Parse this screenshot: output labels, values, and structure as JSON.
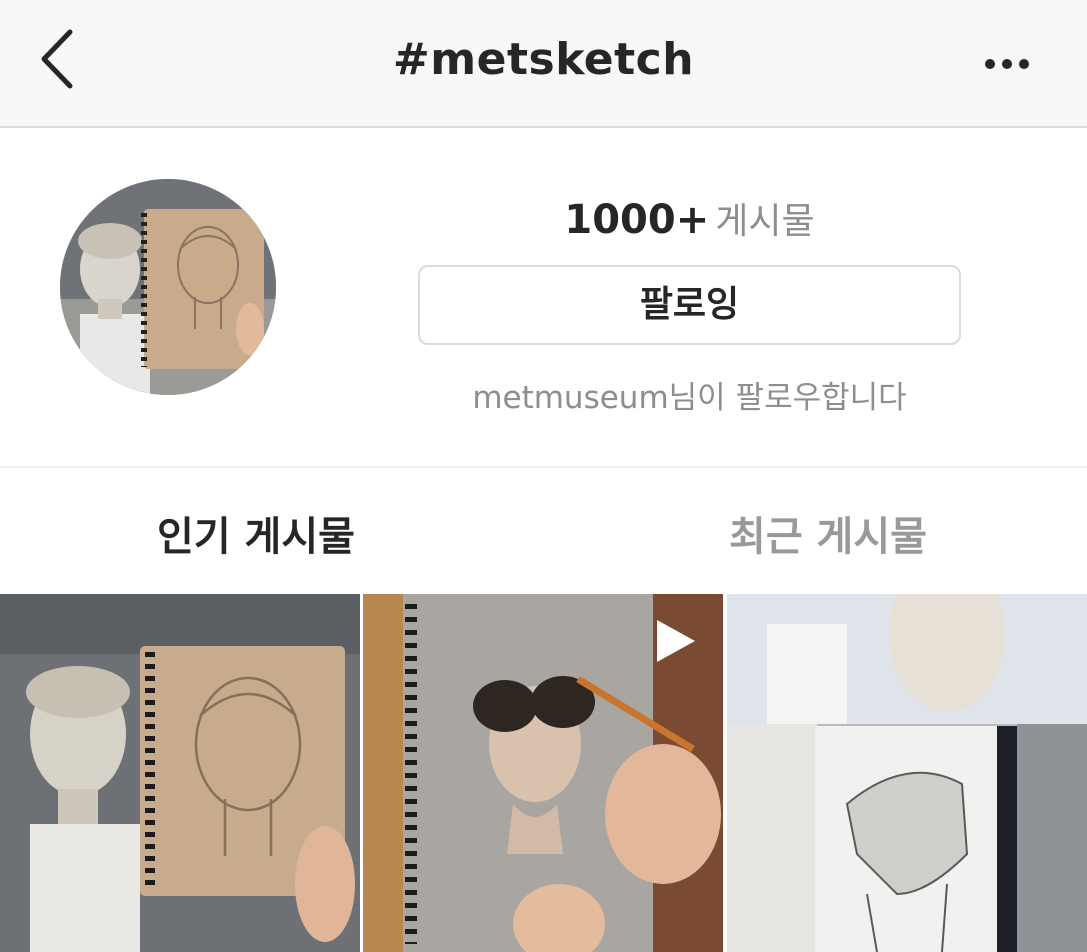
{
  "header": {
    "title": "#metsketch",
    "back_icon": "chevron-left-icon",
    "more_icon": "more-horizontal-icon"
  },
  "profile": {
    "post_count": "1000+",
    "post_count_label": "게시물",
    "follow_button_label": "팔로잉",
    "followed_by_text": "metmuseum님이 팔로우합니다"
  },
  "tabs": [
    {
      "label": "인기 게시물",
      "active": true
    },
    {
      "label": "최근 게시물",
      "active": false
    }
  ],
  "grid": {
    "posts": [
      {
        "kind": "image"
      },
      {
        "kind": "video"
      },
      {
        "kind": "image"
      }
    ]
  },
  "colors": {
    "header_bg": "#f7f7f7",
    "text_primary": "#262626",
    "text_secondary": "#8e8e8e",
    "border": "#dbdbdb"
  }
}
